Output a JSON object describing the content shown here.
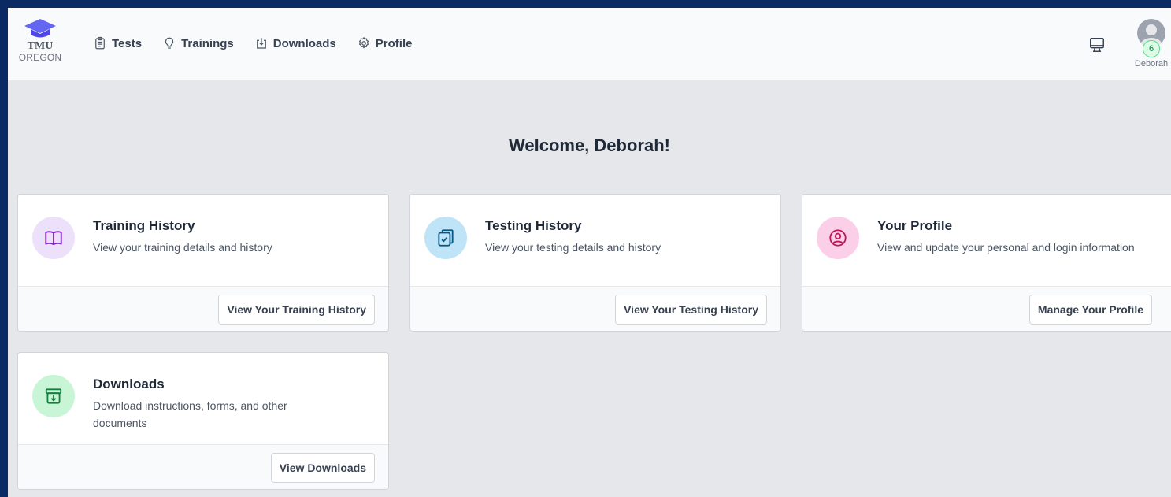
{
  "brand": {
    "line1": "TMU",
    "line2": "OREGON"
  },
  "nav": [
    {
      "label": "Tests",
      "icon": "clipboard-list-icon"
    },
    {
      "label": "Trainings",
      "icon": "lightbulb-icon"
    },
    {
      "label": "Downloads",
      "icon": "download-tray-icon"
    },
    {
      "label": "Profile",
      "icon": "gear-icon"
    }
  ],
  "user": {
    "name": "Deborah",
    "badge_count": "6"
  },
  "welcome": "Welcome, Deborah!",
  "cards": [
    {
      "title": "Training History",
      "description": "View your training details and history",
      "button": "View Your Training History",
      "icon": "open-book-icon",
      "icon_bg": "#ede0fb",
      "icon_color": "#7e22ce"
    },
    {
      "title": "Testing History",
      "description": "View your testing details and history",
      "button": "View Your Testing History",
      "icon": "clipboard-check-icon",
      "icon_bg": "#bfe3f7",
      "icon_color": "#075985"
    },
    {
      "title": "Your Profile",
      "description": "View and update your personal and login information",
      "button": "Manage Your Profile",
      "icon": "user-circle-icon",
      "icon_bg": "#fbcfe8",
      "icon_color": "#be185d"
    },
    {
      "title": "Downloads",
      "description": "Download instructions, forms, and other documents",
      "button": "View Downloads",
      "icon": "archive-download-icon",
      "icon_bg": "#c7f5d6",
      "icon_color": "#15803d"
    }
  ],
  "colors": {
    "page_border": "#0b2a63",
    "background": "#e5e7eb",
    "logo_blue": "#6366f1"
  }
}
